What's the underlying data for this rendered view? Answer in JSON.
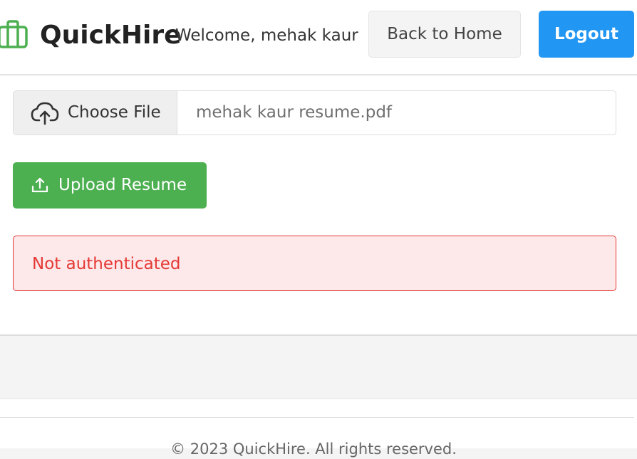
{
  "header": {
    "brand": "QuickHire",
    "welcome": "Welcome, mehak kaur",
    "back_home_label": "Back to Home",
    "logout_label": "Logout"
  },
  "upload_form": {
    "choose_file_label": "Choose File",
    "selected_file": "mehak kaur resume.pdf",
    "upload_button_label": "Upload Resume"
  },
  "alert": {
    "message": "Not authenticated"
  },
  "footer": {
    "copyright": "© 2023 QuickHire. All rights reserved."
  },
  "icons": {
    "logo": "briefcase-icon",
    "choose_file": "cloud-upload-icon",
    "upload": "upload-icon"
  },
  "colors": {
    "brand_green": "#4caf50",
    "logout_blue": "#2196f3",
    "alert_red": "#e53935",
    "alert_background": "#fde8ea"
  }
}
